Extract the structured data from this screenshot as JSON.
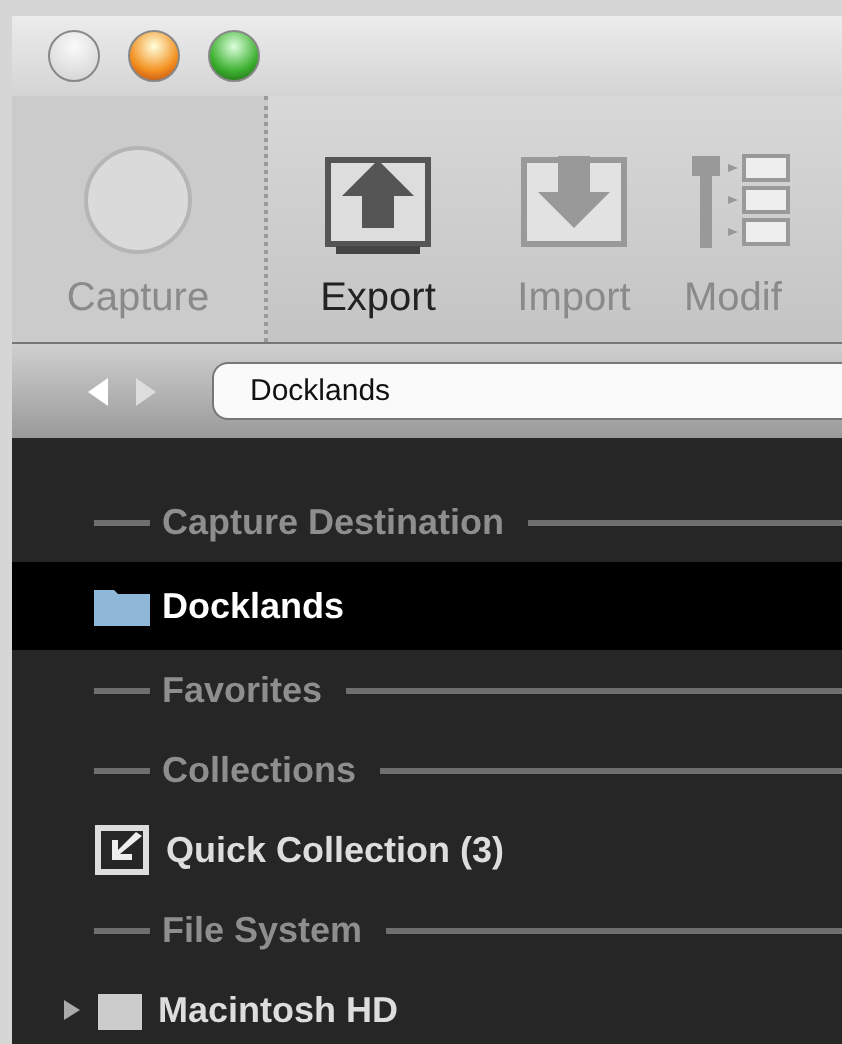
{
  "window": {
    "buttons": [
      {
        "kind": "close",
        "disabled": true
      },
      {
        "kind": "minimize",
        "disabled": false
      },
      {
        "kind": "zoom",
        "disabled": false
      }
    ]
  },
  "toolbar": [
    {
      "kind": "capture",
      "label": "Capture",
      "disabled": true
    },
    {
      "kind": "export",
      "label": "Export",
      "disabled": false
    },
    {
      "kind": "import",
      "label": "Import",
      "disabled": true
    },
    {
      "kind": "modify",
      "label": "Modif",
      "disabled": true
    }
  ],
  "path_bar": {
    "value": "Docklands"
  },
  "source_list": [
    {
      "kind": "header",
      "label": "Capture Destination"
    },
    {
      "kind": "folder",
      "label": "Docklands",
      "selected": true
    },
    {
      "kind": "header",
      "label": "Favorites"
    },
    {
      "kind": "header",
      "label": "Collections"
    },
    {
      "kind": "collection",
      "label": "Quick Collection (3)",
      "selected": false
    },
    {
      "kind": "header",
      "label": "File System"
    },
    {
      "kind": "disk",
      "label": "Macintosh HD",
      "selected": false,
      "expanded": false
    }
  ]
}
